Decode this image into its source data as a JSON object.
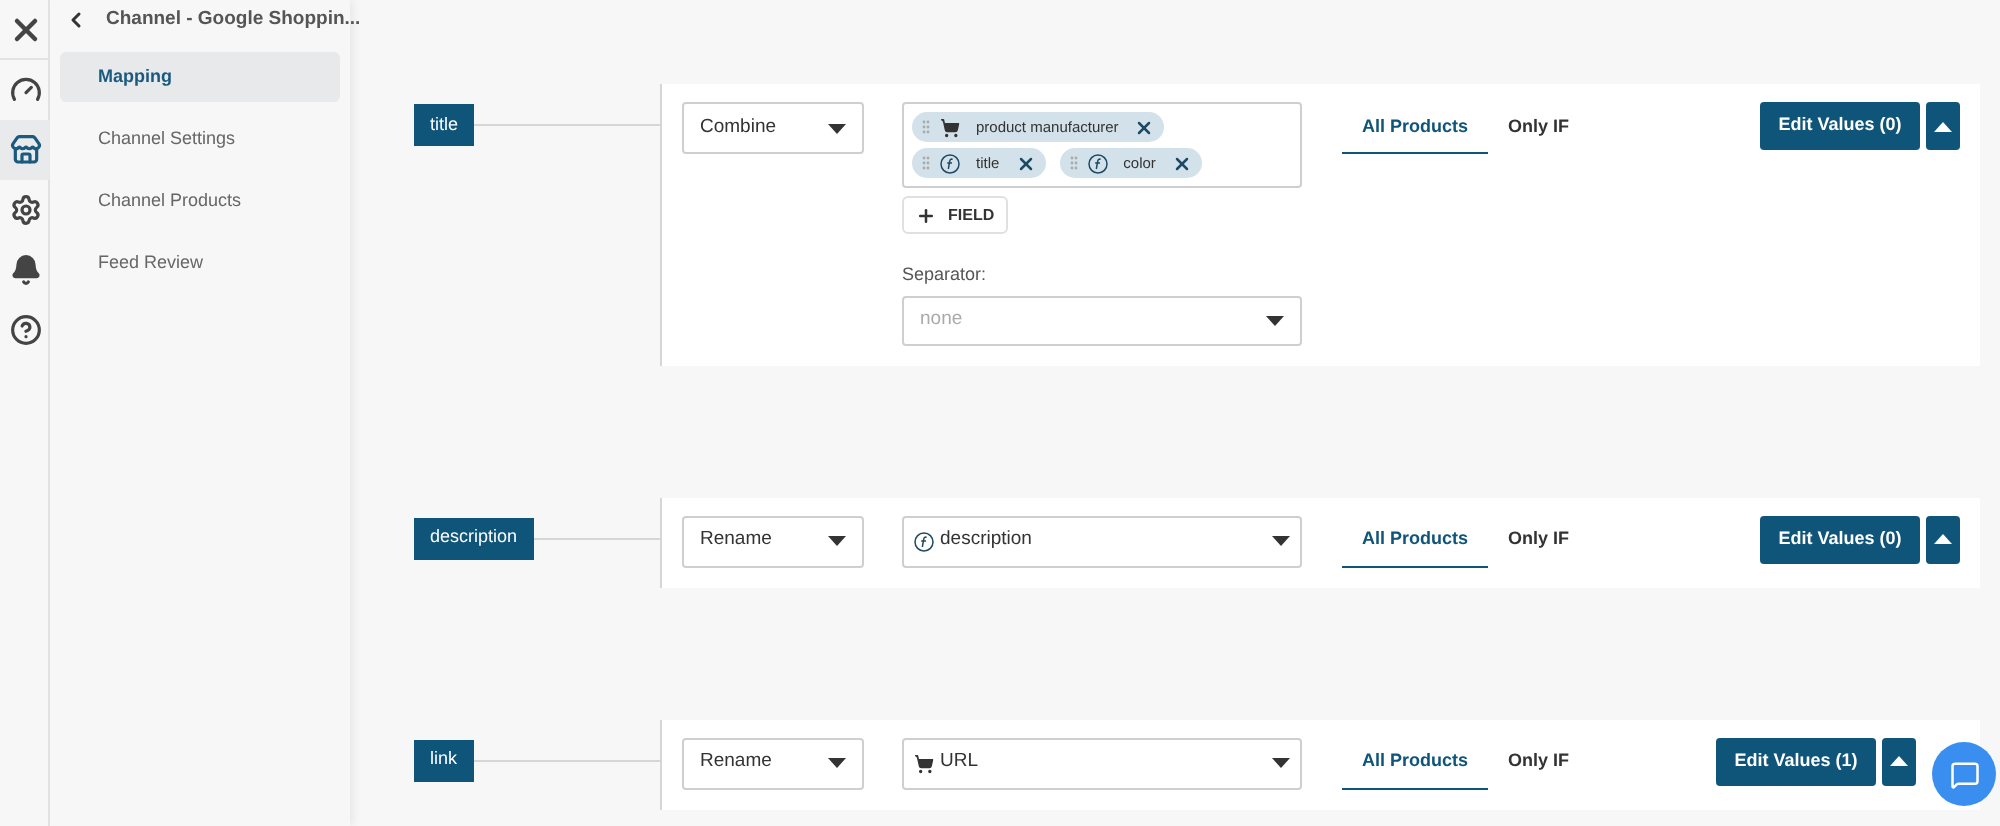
{
  "rail": [
    {
      "kind": "close",
      "selected": false
    },
    {
      "kind": "gauge",
      "selected": false
    },
    {
      "kind": "store",
      "selected": true
    },
    {
      "kind": "gear",
      "selected": false
    },
    {
      "kind": "bell",
      "selected": false
    },
    {
      "kind": "help",
      "selected": false
    }
  ],
  "sidebar": {
    "title": "Channel - Google Shoppin...",
    "items": [
      {
        "label": "Mapping",
        "selected": true
      },
      {
        "label": "Channel Settings",
        "selected": false
      },
      {
        "label": "Channel Products",
        "selected": false
      },
      {
        "label": "Feed Review",
        "selected": false
      }
    ]
  },
  "rows": [
    {
      "attribute": "title",
      "kind": "combine",
      "method": "Combine",
      "chips": [
        {
          "kind": "cart",
          "label": "product manufacturer"
        },
        {
          "kind": "function",
          "label": "title"
        },
        {
          "kind": "function",
          "label": "color"
        }
      ],
      "add_button": "FIELD",
      "separator_label": "Separator:",
      "separator_placeholder": "none",
      "tabs": [
        {
          "label": "All Products",
          "selected": true
        },
        {
          "label": "Only IF",
          "selected": false
        }
      ],
      "edit_button": "Edit Values (0)",
      "expanded": true
    },
    {
      "attribute": "description",
      "kind": "rename",
      "method": "Rename",
      "source": {
        "kind": "function",
        "value": "description"
      },
      "tabs": [
        {
          "label": "All Products",
          "selected": true
        },
        {
          "label": "Only IF",
          "selected": false
        }
      ],
      "edit_button": "Edit Values (0)",
      "expanded": true
    },
    {
      "attribute": "link",
      "kind": "rename",
      "method": "Rename",
      "source": {
        "kind": "cart",
        "value": "URL"
      },
      "tabs": [
        {
          "label": "All Products",
          "selected": true
        },
        {
          "label": "Only IF",
          "selected": false
        }
      ],
      "edit_button": "Edit Values (1)",
      "expanded": true
    }
  ]
}
